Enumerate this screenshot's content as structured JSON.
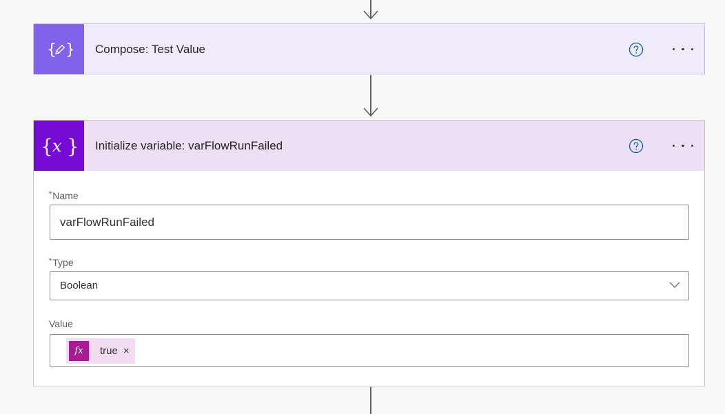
{
  "compose": {
    "title": "Compose: Test Value",
    "icon": "compose-braces-pencil-icon",
    "accent_color": "#8162ea",
    "bg_color": "#f0ebfb"
  },
  "init_variable": {
    "title": "Initialize variable: varFlowRunFailed",
    "icon": "variable-braces-x-icon",
    "accent_color": "#770bd6",
    "header_bg_color": "#eedff5",
    "name": {
      "label": "Name",
      "required": "*",
      "value": "varFlowRunFailed"
    },
    "type": {
      "label": "Type",
      "required": "*",
      "selected": "Boolean"
    },
    "value": {
      "label": "Value",
      "token_label": "true",
      "token_icon": "fx",
      "token_color": "#a51d91",
      "token_close": "×"
    }
  }
}
